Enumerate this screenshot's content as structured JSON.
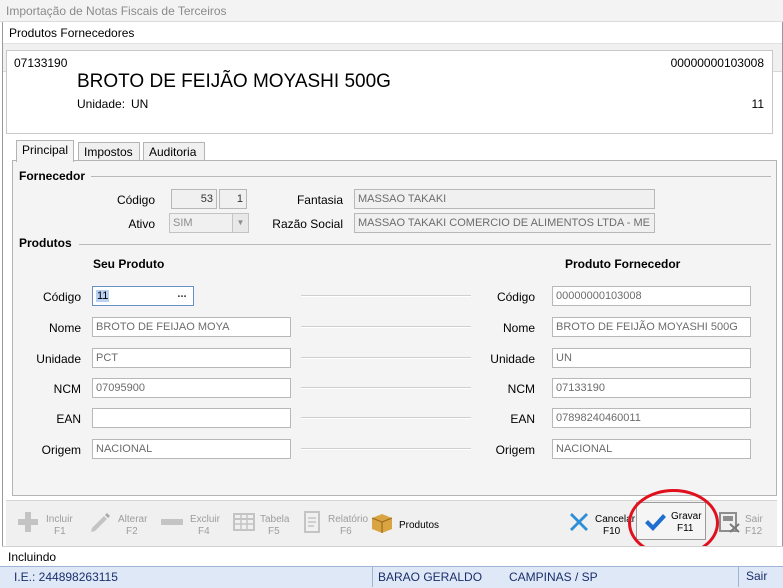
{
  "parent_window": {
    "title": "Importação de Notas Fiscais de Terceiros"
  },
  "dialog": {
    "title": "Produtos Fornecedores"
  },
  "nav": {
    "first": "|◁",
    "prev": "◁",
    "next": "▷",
    "last": "▷|"
  },
  "header": {
    "ncm": "07133190",
    "code": "00000000103008",
    "product_name": "BROTO DE FEIJÃO MOYASHI 500G",
    "unit_label": "Unidade:",
    "unit_value": "UN",
    "count": "11"
  },
  "tabs": [
    {
      "label": "Principal",
      "active": true
    },
    {
      "label": "Impostos",
      "active": false
    },
    {
      "label": "Auditoria",
      "active": false
    }
  ],
  "fornecedor": {
    "section_title": "Fornecedor",
    "codigo_label": "Código",
    "codigo_value": "53",
    "codigo_seq": "1",
    "ativo_label": "Ativo",
    "ativo_value": "SIM",
    "fantasia_label": "Fantasia",
    "fantasia_value": "MASSAO TAKAKI",
    "razao_label": "Razão Social",
    "razao_value": "MASSAO TAKAKI COMERCIO DE ALIMENTOS LTDA - ME"
  },
  "produtos": {
    "section_title": "Produtos",
    "seu_produto_title": "Seu Produto",
    "produto_fornecedor_title": "Produto Fornecedor",
    "rows": [
      {
        "label": "Código",
        "left": "11",
        "right_label": "Código",
        "right": "00000000103008"
      },
      {
        "label": "Nome",
        "left": "BROTO DE FEIJAO MOYA",
        "right_label": "Nome",
        "right": "BROTO DE FEIJÃO MOYASHI 500G"
      },
      {
        "label": "Unidade",
        "left": "PCT",
        "right_label": "Unidade",
        "right": "UN"
      },
      {
        "label": "NCM",
        "left": "07095900",
        "right_label": "NCM",
        "right": "07133190"
      },
      {
        "label": "EAN",
        "left": "",
        "right_label": "EAN",
        "right": "07898240460011"
      },
      {
        "label": "Origem",
        "left": "NACIONAL",
        "right_label": "Origem",
        "right": "NACIONAL"
      }
    ],
    "lookup_button": "..."
  },
  "toolbar": {
    "incluir": {
      "label": "Incluir",
      "key": "F1"
    },
    "alterar": {
      "label": "Alterar",
      "key": "F2"
    },
    "excluir": {
      "label": "Excluir",
      "key": "F4"
    },
    "tabela": {
      "label": "Tabela",
      "key": "F5"
    },
    "relatorio": {
      "label": "Relatório",
      "key": "F6"
    },
    "produtos": {
      "label": "Produtos"
    },
    "cancelar": {
      "label": "Cancelar",
      "key": "F10"
    },
    "gravar": {
      "label": "Gravar",
      "key": "F11"
    },
    "sair": {
      "label": "Sair",
      "key": "F12"
    }
  },
  "status": {
    "mode": "Incluindo"
  },
  "parent_status": {
    "ie": "I.E.: 244898263115",
    "bairro": "BARAO GERALDO",
    "cidade": "CAMPINAS / SP",
    "sair": "Sair"
  },
  "colors": {
    "highlight": "#e0101e",
    "cancel_icon": "#2e8fd8",
    "check_icon": "#1e6fd0",
    "box_icon": "#c48a2c"
  }
}
